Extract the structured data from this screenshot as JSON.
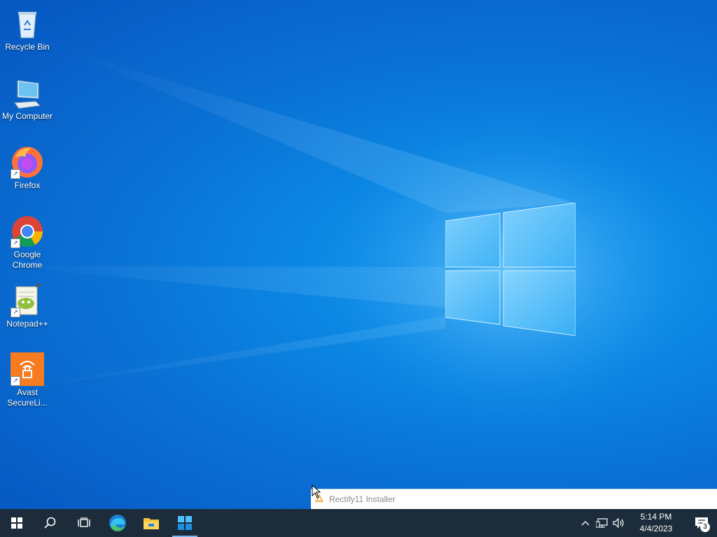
{
  "desktop": {
    "icons": [
      {
        "label": "Recycle Bin",
        "icon": "recycle-bin-icon"
      },
      {
        "label": "My Computer",
        "icon": "computer-icon"
      },
      {
        "label": "Firefox",
        "icon": "firefox-icon"
      },
      {
        "label": "Google Chrome",
        "icon": "chrome-icon"
      },
      {
        "label": "Notepad++",
        "icon": "notepadpp-icon"
      },
      {
        "label": "Avast SecureLi...",
        "icon": "avast-secureline-icon"
      }
    ]
  },
  "installer_window": {
    "title": "Rectify11 Installer",
    "icon": "rectify11-icon"
  },
  "taskbar": {
    "buttons": [
      {
        "name": "start",
        "icon": "windows-start-icon"
      },
      {
        "name": "search",
        "icon": "search-icon"
      },
      {
        "name": "task-view",
        "icon": "task-view-icon"
      },
      {
        "name": "edge",
        "icon": "edge-icon"
      },
      {
        "name": "file-explorer",
        "icon": "folder-icon"
      },
      {
        "name": "rectify11-installer",
        "icon": "rectify11-taskbar-icon"
      }
    ],
    "tray": {
      "time": "5:14 PM",
      "date": "4/4/2023",
      "notification_count": "3"
    }
  },
  "colors": {
    "taskbar": "#1c2c3a",
    "accent": "#78b8ee",
    "desktop": "#0b86e3"
  }
}
